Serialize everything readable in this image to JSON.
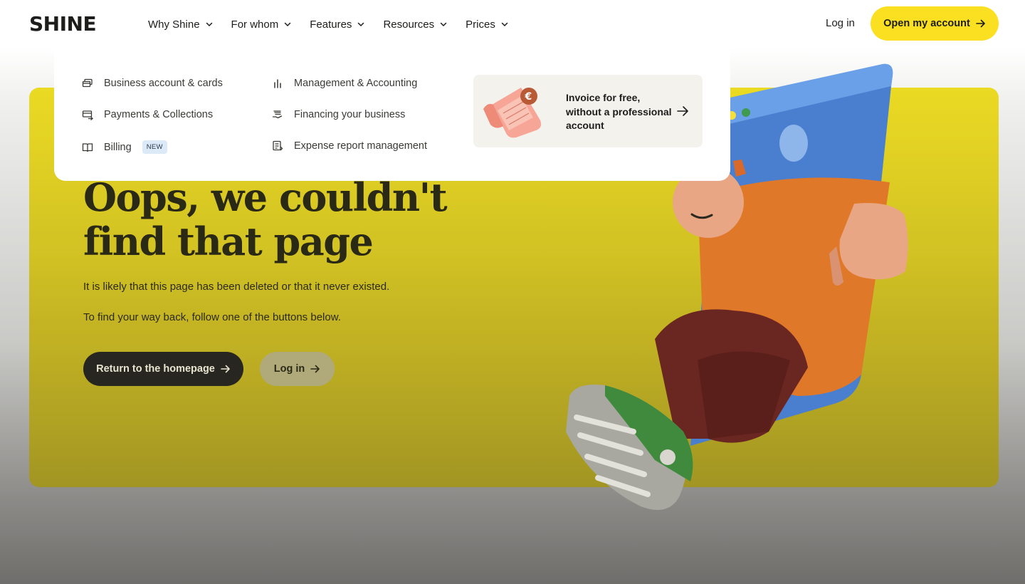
{
  "header": {
    "logo": "SHINE",
    "nav": [
      {
        "label": "Why Shine"
      },
      {
        "label": "For whom"
      },
      {
        "label": "Features"
      },
      {
        "label": "Resources"
      },
      {
        "label": "Prices"
      }
    ],
    "login": "Log in",
    "cta": "Open my account"
  },
  "dropdown": {
    "col1": [
      {
        "label": "Business account & cards",
        "icon": "cards-icon"
      },
      {
        "label": "Payments & Collections",
        "icon": "payments-icon"
      },
      {
        "label": "Billing",
        "icon": "book-icon",
        "badge": "NEW"
      }
    ],
    "col2": [
      {
        "label": "Management & Accounting",
        "icon": "bar-chart-icon"
      },
      {
        "label": "Financing your business",
        "icon": "hand-coins-icon"
      },
      {
        "label": "Expense report management",
        "icon": "receipt-icon"
      }
    ],
    "promo": {
      "text": "Invoice for free, without a professional account",
      "icon": "invoice-illustration"
    }
  },
  "hero": {
    "title": "Oops, we couldn't find that page",
    "text1": "It is likely that this page has been deleted or that it never existed.",
    "text2": "To find your way back, follow one of the buttons below.",
    "btn_home": "Return to the homepage",
    "btn_login": "Log in"
  },
  "colors": {
    "accent": "#fbe022",
    "dark": "#272620"
  }
}
